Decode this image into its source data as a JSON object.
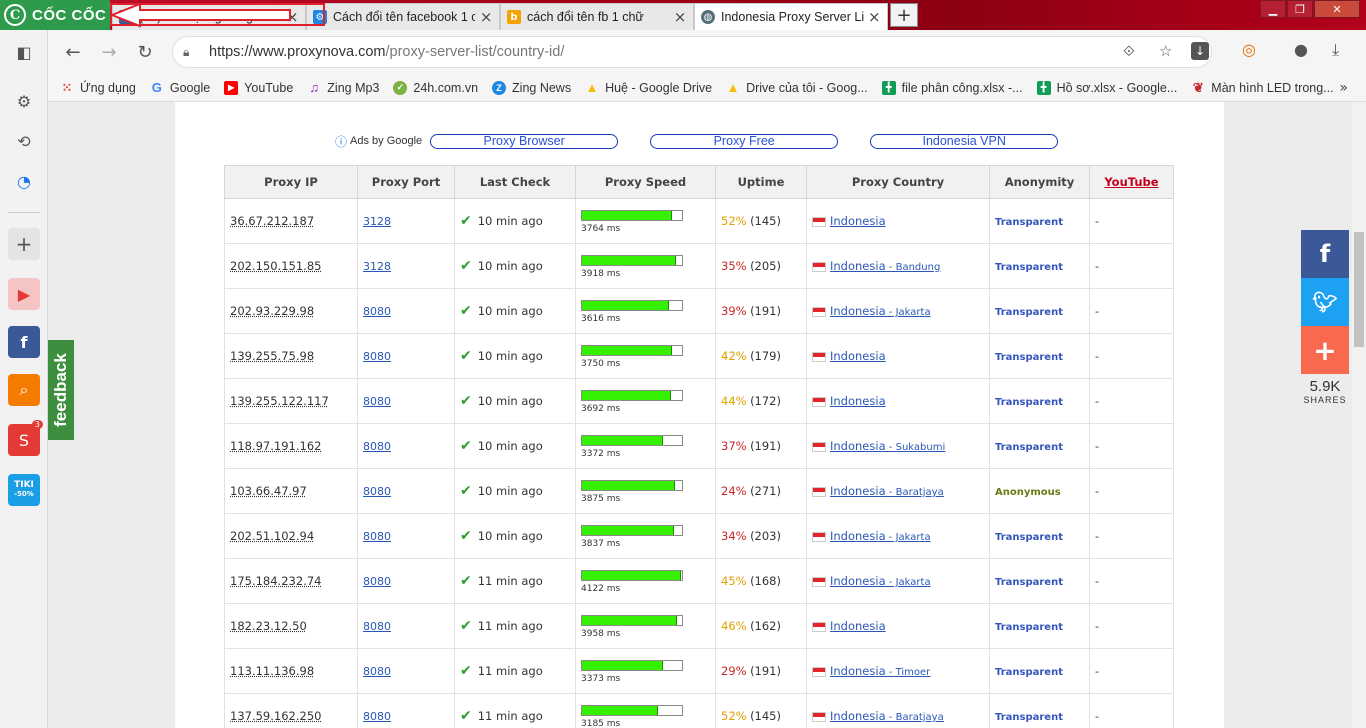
{
  "browser": {
    "brand": "CỐC CỐC",
    "tabs": [
      {
        "title": "(68) Cài đặt ngôn ngữ và v",
        "favicon": "facebook-icon",
        "color": "#3b5998",
        "active": false
      },
      {
        "title": "Cách đổi tên facebook 1 c",
        "favicon": "gear-icon",
        "color": "#1e88e5",
        "active": false
      },
      {
        "title": "cách đổi tên fb 1 chữ",
        "favicon": "blogger-icon",
        "color": "#f4a300",
        "active": false
      },
      {
        "title": "Indonesia Proxy Server Lis",
        "favicon": "globe-icon",
        "color": "#546e7a",
        "active": true
      }
    ],
    "url": {
      "host": "https://www.proxynova.com",
      "path": "/proxy-server-list/country-id/"
    },
    "bookmarks": [
      {
        "label": "Ứng dụng",
        "icon": "apps-icon",
        "color": "#e53935"
      },
      {
        "label": "Google",
        "icon": "google-icon",
        "color": "#4285f4"
      },
      {
        "label": "YouTube",
        "icon": "youtube-icon",
        "color": "#ff0000"
      },
      {
        "label": "Zing Mp3",
        "icon": "music-icon",
        "color": "#8e24aa"
      },
      {
        "label": "24h.com.vn",
        "icon": "check-circle-icon",
        "color": "#7cb342"
      },
      {
        "label": "Zing News",
        "icon": "z-icon",
        "color": "#1e88e5"
      },
      {
        "label": "Huệ - Google Drive",
        "icon": "drive-icon",
        "color": "#fbbc04"
      },
      {
        "label": "Drive của tôi - Goog...",
        "icon": "drive-icon",
        "color": "#fbbc04"
      },
      {
        "label": "file phân công.xlsx -...",
        "icon": "sheets-icon",
        "color": "#0f9d58"
      },
      {
        "label": "Hồ sơ.xlsx - Google...",
        "icon": "sheets-icon",
        "color": "#0f9d58"
      },
      {
        "label": "Màn hình LED trong...",
        "icon": "swirl-icon",
        "color": "#c62828"
      }
    ],
    "bookmarks_more": "»"
  },
  "ads": {
    "label": "Ads by Google",
    "links": [
      "Proxy Browser",
      "Proxy Free",
      "Indonesia VPN"
    ]
  },
  "table": {
    "headers": [
      "Proxy IP",
      "Proxy Port",
      "Last Check",
      "Proxy Speed",
      "Uptime",
      "Proxy Country",
      "Anonymity",
      "YouTube"
    ],
    "rows": [
      {
        "ip": "36.67.212.187",
        "port": "3128",
        "last": "10 min ago",
        "speed": 3764,
        "speed_label": "3764 ms",
        "uptime": "52%",
        "uptime_count": "(145)",
        "uptime_color": "#e0a000",
        "country": "Indonesia",
        "region": "",
        "anonymity": "Transparent",
        "youtube": "-"
      },
      {
        "ip": "202.150.151.85",
        "port": "3128",
        "last": "10 min ago",
        "speed": 3918,
        "speed_label": "3918 ms",
        "uptime": "35%",
        "uptime_count": "(205)",
        "uptime_color": "#c62828",
        "country": "Indonesia",
        "region": " - Bandung",
        "anonymity": "Transparent",
        "youtube": "-"
      },
      {
        "ip": "202.93.229.98",
        "port": "8080",
        "last": "10 min ago",
        "speed": 3616,
        "speed_label": "3616 ms",
        "uptime": "39%",
        "uptime_count": "(191)",
        "uptime_color": "#c62828",
        "country": "Indonesia",
        "region": " - Jakarta",
        "anonymity": "Transparent",
        "youtube": "-"
      },
      {
        "ip": "139.255.75.98",
        "port": "8080",
        "last": "10 min ago",
        "speed": 3750,
        "speed_label": "3750 ms",
        "uptime": "42%",
        "uptime_count": "(179)",
        "uptime_color": "#e0a000",
        "country": "Indonesia",
        "region": "",
        "anonymity": "Transparent",
        "youtube": "-"
      },
      {
        "ip": "139.255.122.117",
        "port": "8080",
        "last": "10 min ago",
        "speed": 3692,
        "speed_label": "3692 ms",
        "uptime": "44%",
        "uptime_count": "(172)",
        "uptime_color": "#e0a000",
        "country": "Indonesia",
        "region": "",
        "anonymity": "Transparent",
        "youtube": "-"
      },
      {
        "ip": "118.97.191.162",
        "port": "8080",
        "last": "10 min ago",
        "speed": 3372,
        "speed_label": "3372 ms",
        "uptime": "37%",
        "uptime_count": "(191)",
        "uptime_color": "#c62828",
        "country": "Indonesia",
        "region": " - Sukabumi",
        "anonymity": "Transparent",
        "youtube": "-"
      },
      {
        "ip": "103.66.47.97",
        "port": "8080",
        "last": "10 min ago",
        "speed": 3875,
        "speed_label": "3875 ms",
        "uptime": "24%",
        "uptime_count": "(271)",
        "uptime_color": "#c62828",
        "country": "Indonesia",
        "region": " - Baratjaya",
        "anonymity": "Anonymous",
        "youtube": "-"
      },
      {
        "ip": "202.51.102.94",
        "port": "8080",
        "last": "10 min ago",
        "speed": 3837,
        "speed_label": "3837 ms",
        "uptime": "34%",
        "uptime_count": "(203)",
        "uptime_color": "#c62828",
        "country": "Indonesia",
        "region": " - Jakarta",
        "anonymity": "Transparent",
        "youtube": "-"
      },
      {
        "ip": "175.184.232.74",
        "port": "8080",
        "last": "11 min ago",
        "speed": 4122,
        "speed_label": "4122 ms",
        "uptime": "45%",
        "uptime_count": "(168)",
        "uptime_color": "#e0a000",
        "country": "Indonesia",
        "region": " - Jakarta",
        "anonymity": "Transparent",
        "youtube": "-"
      },
      {
        "ip": "182.23.12.50",
        "port": "8080",
        "last": "11 min ago",
        "speed": 3958,
        "speed_label": "3958 ms",
        "uptime": "46%",
        "uptime_count": "(162)",
        "uptime_color": "#e0a000",
        "country": "Indonesia",
        "region": "",
        "anonymity": "Transparent",
        "youtube": "-"
      },
      {
        "ip": "113.11.136.98",
        "port": "8080",
        "last": "11 min ago",
        "speed": 3373,
        "speed_label": "3373 ms",
        "uptime": "29%",
        "uptime_count": "(191)",
        "uptime_color": "#c62828",
        "country": "Indonesia",
        "region": " - Timoer",
        "anonymity": "Transparent",
        "youtube": "-"
      },
      {
        "ip": "137.59.162.250",
        "port": "8080",
        "last": "11 min ago",
        "speed": 3185,
        "speed_label": "3185 ms",
        "uptime": "52%",
        "uptime_count": "(145)",
        "uptime_color": "#e0a000",
        "country": "Indonesia",
        "region": " - Baratjaya",
        "anonymity": "Transparent",
        "youtube": "-"
      }
    ],
    "speed_max": 4170,
    "anonymity_colors": {
      "Transparent": "#3355bb",
      "Anonymous": "#6b7a12"
    }
  },
  "feedback": "feedback",
  "share": {
    "count": "5.9K",
    "label": "SHARES",
    "facebook_color": "#3b5998",
    "twitter_color": "#1da1f2",
    "more_color": "#f8694d"
  },
  "sidebar_badges": {
    "shopee": "3",
    "tiki": "-50%"
  }
}
